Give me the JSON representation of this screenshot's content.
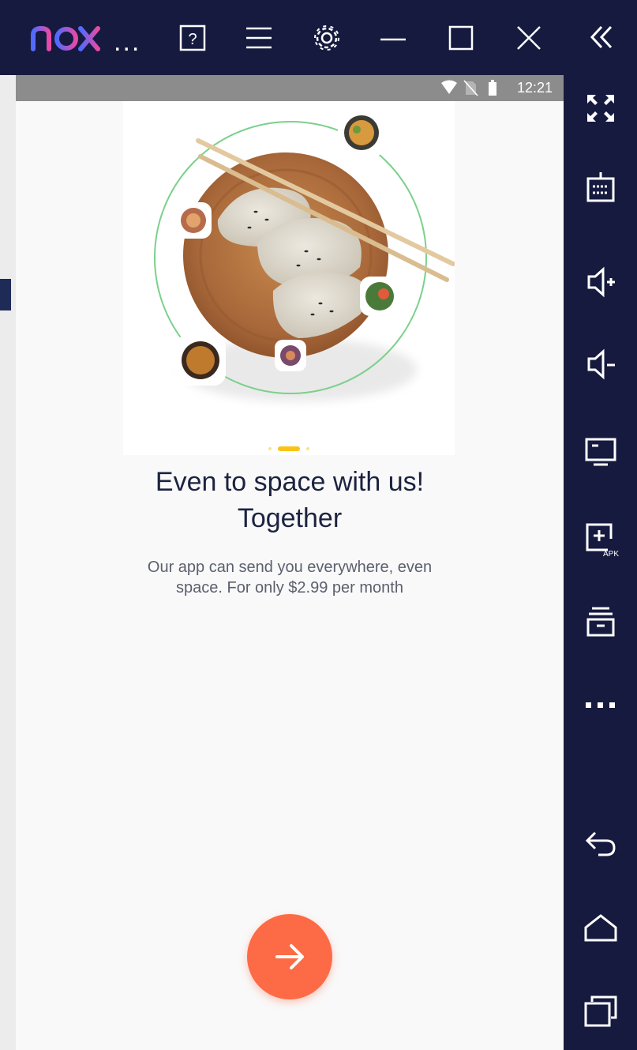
{
  "emulator": {
    "brand": "nox",
    "more": "...",
    "toolbar_icons": [
      "help-icon",
      "menu-icon",
      "settings-icon",
      "minimize-icon",
      "maximize-icon",
      "close-icon",
      "collapse-icon"
    ],
    "side_icons": [
      "fullscreen-icon",
      "keyboard-icon",
      "volume-up-icon",
      "volume-down-icon",
      "screen-icon",
      "apk-install-icon",
      "multi-instance-icon",
      "more-icon",
      "back-icon",
      "home-icon",
      "recents-icon"
    ],
    "colors": {
      "bar": "#161a3f",
      "logo_start": "#4f6bff",
      "logo_end": "#e84aa6"
    }
  },
  "status_bar": {
    "time": "12:21",
    "icons": [
      "wifi-icon",
      "no-sim-icon",
      "battery-icon"
    ]
  },
  "onboarding": {
    "title_line1": "Even to space with us!",
    "title_line2": "Together",
    "description_line1": "Our app can send you everywhere, even",
    "description_line2": "space. For only $2.99 per month",
    "page_indicator": {
      "pages": 3,
      "active": 2
    },
    "next_button_icon": "arrow-right-icon",
    "colors": {
      "accent": "#fd6a46",
      "indicator": "#f9c41a",
      "title": "#1c2340",
      "text": "#5b5f6e",
      "ring": "#7bd08b"
    }
  }
}
